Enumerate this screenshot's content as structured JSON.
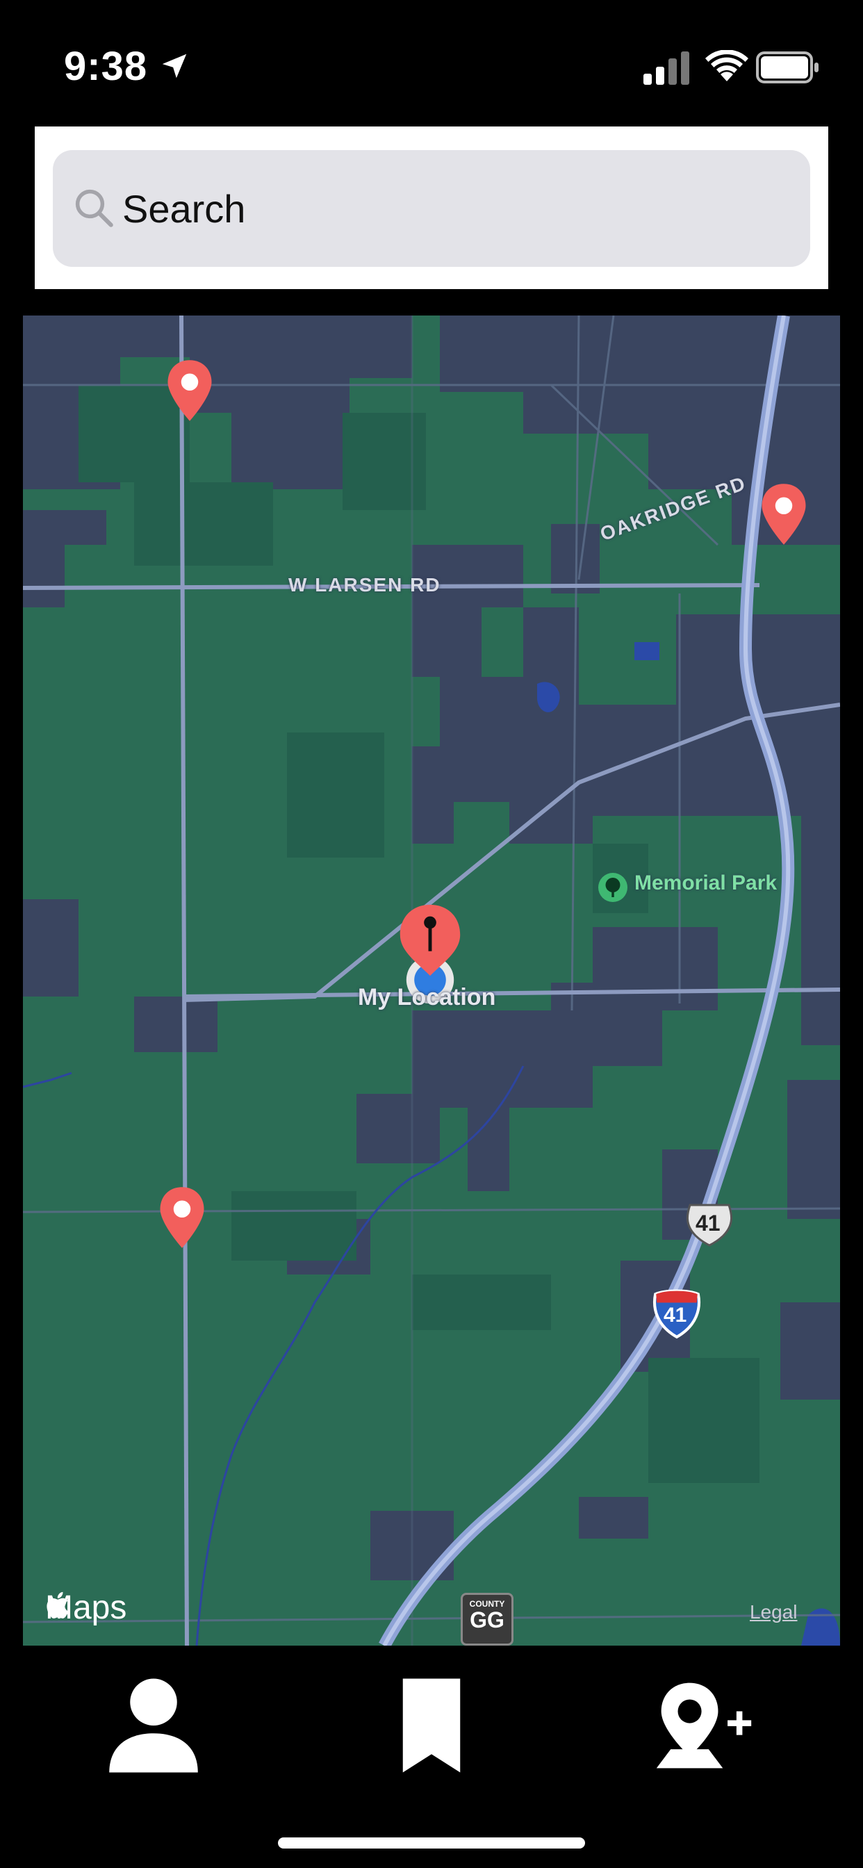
{
  "status_bar": {
    "time": "9:38"
  },
  "search": {
    "placeholder": "Search"
  },
  "map": {
    "road_labels": [
      "W LARSEN RD",
      "OAKRIDGE RD"
    ],
    "poi": {
      "name": "Memorial Park"
    },
    "my_location_label": "My Location",
    "shields": {
      "us_route": "41",
      "interstate": "41",
      "county_top": "COUNTY",
      "county": "GG"
    },
    "attribution": "Maps",
    "legal": "Legal",
    "pin_color": "#f25f5c",
    "user_dot_color": "#2f7de1"
  },
  "tab_bar": {
    "items": [
      "profile-icon",
      "bookmark-icon",
      "add-location-icon"
    ]
  }
}
